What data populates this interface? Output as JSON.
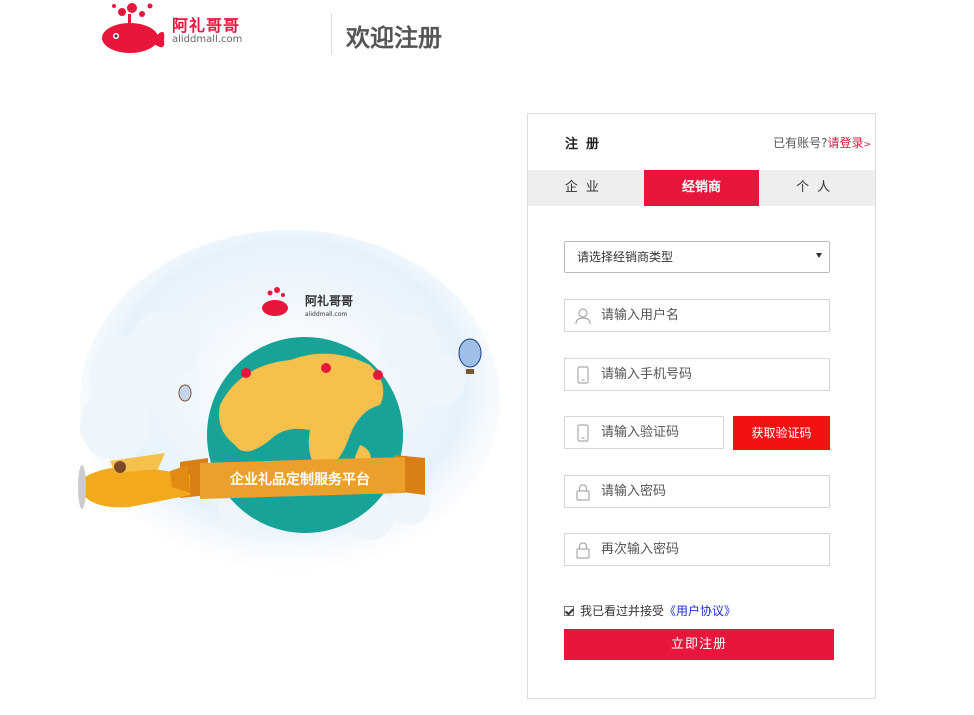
{
  "header": {
    "logo_text": "阿礼哥哥",
    "logo_domain": "aliddmall.com",
    "page_title": "欢迎注册"
  },
  "illustration": {
    "logo_text": "阿礼哥哥",
    "logo_domain": "aliddmall.com",
    "banner_text": "企业礼品定制服务平台"
  },
  "panel": {
    "title": "注册",
    "login_prompt": "已有账号?",
    "login_link": "请登录",
    "login_arrow": ">",
    "tabs": [
      {
        "label": "企业"
      },
      {
        "label": "经销商",
        "active": true
      },
      {
        "label": "个人"
      }
    ],
    "dealer_type_placeholder": "请选择经销商类型",
    "username_placeholder": "请输入用户名",
    "phone_placeholder": "请输入手机号码",
    "code_placeholder": "请输入验证码",
    "get_code_label": "获取验证码",
    "password_placeholder": "请输入密码",
    "confirm_placeholder": "再次输入密码",
    "agree_text": "我已看过并接受",
    "agree_link": "《用户协议》",
    "submit_label": "立即注册"
  },
  "colors": {
    "brand_red": "#e8163c",
    "code_button_red": "#f21212",
    "link_blue": "#1b2fd0"
  }
}
